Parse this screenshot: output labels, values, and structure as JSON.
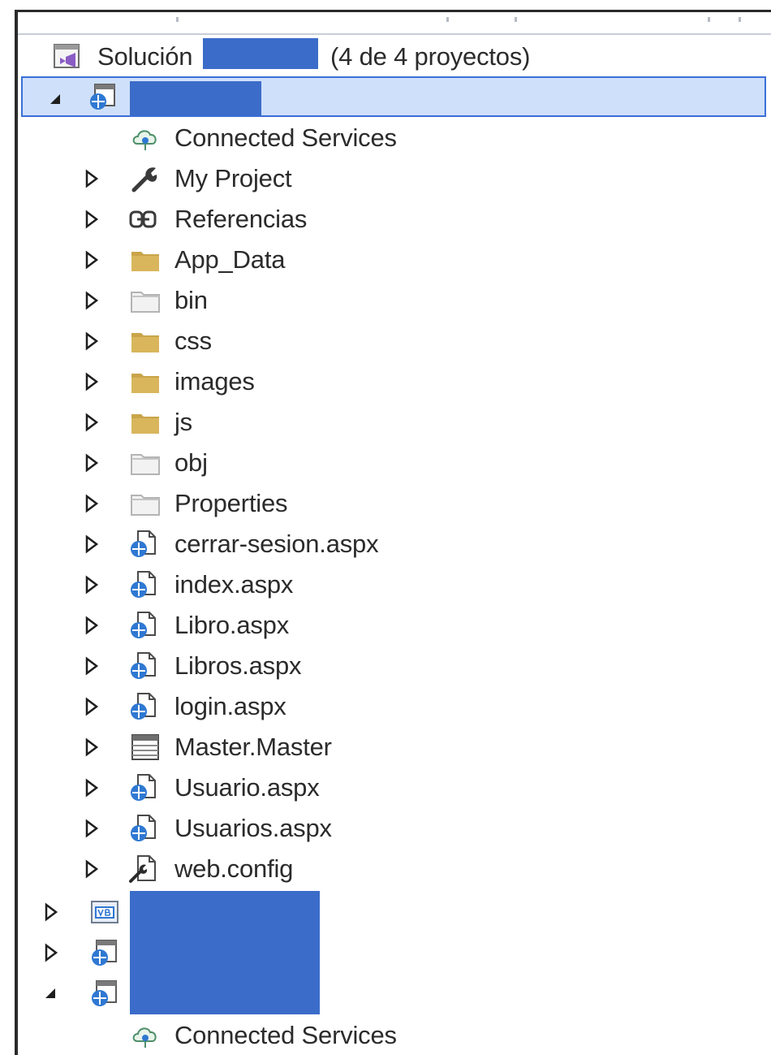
{
  "solution": {
    "label": "Solución",
    "count_text": "(4 de 4 proyectos)"
  },
  "project1": {
    "items": [
      {
        "label": "Connected Services",
        "icon": "connected-services-icon"
      },
      {
        "label": "My Project",
        "icon": "wrench-icon"
      },
      {
        "label": "Referencias",
        "icon": "references-icon"
      },
      {
        "label": "App_Data",
        "icon": "folder-icon"
      },
      {
        "label": "bin",
        "icon": "folder-hidden-icon"
      },
      {
        "label": "css",
        "icon": "folder-icon"
      },
      {
        "label": "images",
        "icon": "folder-icon"
      },
      {
        "label": "js",
        "icon": "folder-icon"
      },
      {
        "label": "obj",
        "icon": "folder-hidden-icon"
      },
      {
        "label": "Properties",
        "icon": "folder-hidden-icon"
      },
      {
        "label": "cerrar-sesion.aspx",
        "icon": "aspx-file-icon"
      },
      {
        "label": "index.aspx",
        "icon": "aspx-file-icon"
      },
      {
        "label": "Libro.aspx",
        "icon": "aspx-file-icon"
      },
      {
        "label": "Libros.aspx",
        "icon": "aspx-file-icon"
      },
      {
        "label": "login.aspx",
        "icon": "aspx-file-icon"
      },
      {
        "label": "Master.Master",
        "icon": "master-page-icon"
      },
      {
        "label": "Usuario.aspx",
        "icon": "aspx-file-icon"
      },
      {
        "label": "Usuarios.aspx",
        "icon": "aspx-file-icon"
      },
      {
        "label": "web.config",
        "icon": "config-file-icon"
      }
    ]
  },
  "project4": {
    "items": [
      {
        "label": "Connected Services",
        "icon": "connected-services-icon"
      }
    ]
  },
  "colors": {
    "selection_bg": "#cfe0fb",
    "selection_border": "#3b6fd6",
    "redaction": "#3b6cc9",
    "folder": "#c9a44a"
  }
}
